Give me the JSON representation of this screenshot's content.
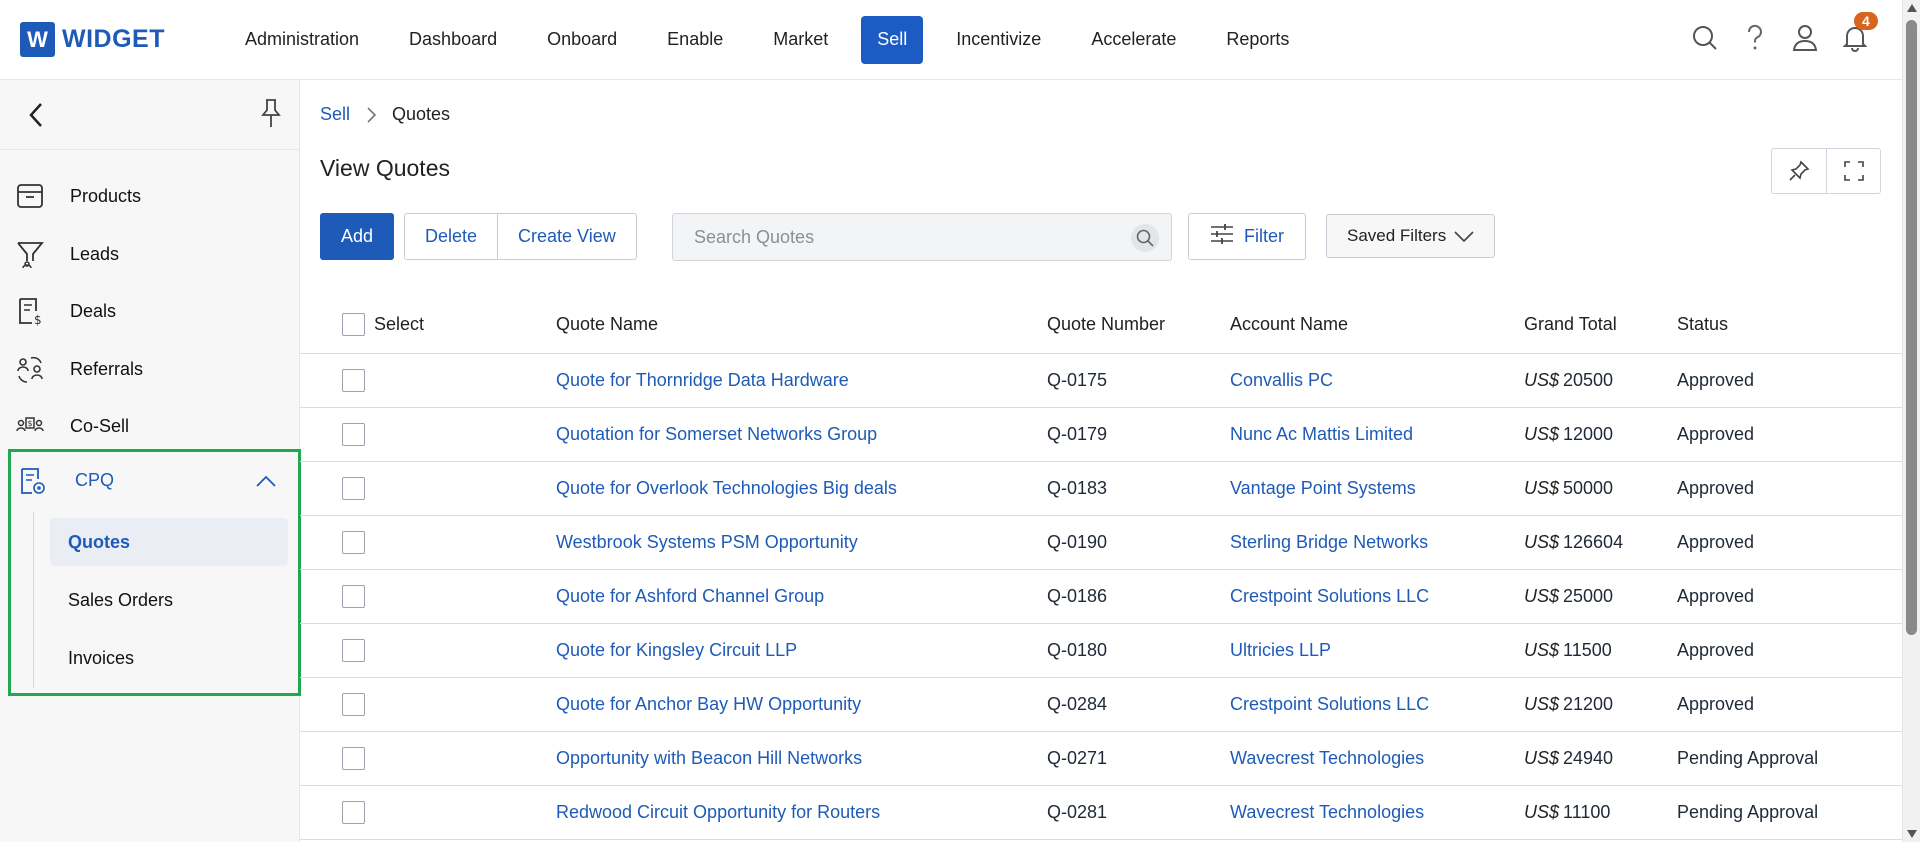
{
  "app": {
    "logo_letter": "W",
    "logo_text": "WIDGET"
  },
  "nav": {
    "items": [
      "Administration",
      "Dashboard",
      "Onboard",
      "Enable",
      "Market",
      "Sell",
      "Incentivize",
      "Accelerate",
      "Reports"
    ],
    "active": "Sell"
  },
  "top_icons": {
    "notification_count": "4"
  },
  "sidebar": {
    "items": [
      {
        "label": "Products",
        "icon": "box-icon"
      },
      {
        "label": "Leads",
        "icon": "funnel-icon"
      },
      {
        "label": "Deals",
        "icon": "dollar-document-icon"
      },
      {
        "label": "Referrals",
        "icon": "referrals-icon"
      },
      {
        "label": "Co-Sell",
        "icon": "co-sell-icon"
      }
    ],
    "cpq": {
      "label": "CPQ",
      "sub_items": [
        "Quotes",
        "Sales Orders",
        "Invoices"
      ],
      "active_sub": "Quotes"
    },
    "highlight_color": "#1fa84f"
  },
  "breadcrumb": {
    "parent": "Sell",
    "current": "Quotes"
  },
  "page": {
    "title": "View Quotes"
  },
  "toolbar": {
    "add_label": "Add",
    "delete_label": "Delete",
    "create_view_label": "Create View",
    "search_placeholder": "Search Quotes",
    "filter_label": "Filter",
    "saved_filters_label": "Saved Filters"
  },
  "table": {
    "headers": {
      "select": "Select",
      "quote_name": "Quote Name",
      "quote_number": "Quote Number",
      "account_name": "Account Name",
      "grand_total": "Grand Total",
      "status": "Status"
    },
    "currency": "US$",
    "rows": [
      {
        "quote_name": "Quote for Thornridge Data Hardware",
        "quote_number": "Q-0175",
        "account_name": "Convallis PC",
        "grand_total": "20500",
        "status": "Approved"
      },
      {
        "quote_name": "Quotation for Somerset Networks Group",
        "quote_number": "Q-0179",
        "account_name": "Nunc Ac Mattis Limited",
        "grand_total": "12000",
        "status": "Approved"
      },
      {
        "quote_name": "Quote for Overlook Technologies Big deals",
        "quote_number": "Q-0183",
        "account_name": "Vantage Point Systems",
        "grand_total": "50000",
        "status": "Approved"
      },
      {
        "quote_name": "Westbrook Systems PSM Opportunity",
        "quote_number": "Q-0190",
        "account_name": "Sterling Bridge Networks",
        "grand_total": "126604",
        "status": "Approved"
      },
      {
        "quote_name": "Quote for Ashford Channel Group",
        "quote_number": "Q-0186",
        "account_name": "Crestpoint Solutions LLC",
        "grand_total": "25000",
        "status": "Approved"
      },
      {
        "quote_name": "Quote for Kingsley Circuit LLP",
        "quote_number": "Q-0180",
        "account_name": "Ultricies LLP",
        "grand_total": "11500",
        "status": "Approved"
      },
      {
        "quote_name": "Quote for Anchor Bay HW Opportunity",
        "quote_number": "Q-0284",
        "account_name": "Crestpoint Solutions LLC",
        "grand_total": "21200",
        "status": "Approved"
      },
      {
        "quote_name": "Opportunity with Beacon Hill Networks",
        "quote_number": "Q-0271",
        "account_name": "Wavecrest Technologies",
        "grand_total": "24940",
        "status": "Pending Approval"
      },
      {
        "quote_name": "Redwood Circuit Opportunity for Routers",
        "quote_number": "Q-0281",
        "account_name": "Wavecrest Technologies",
        "grand_total": "11100",
        "status": "Pending Approval"
      }
    ]
  }
}
